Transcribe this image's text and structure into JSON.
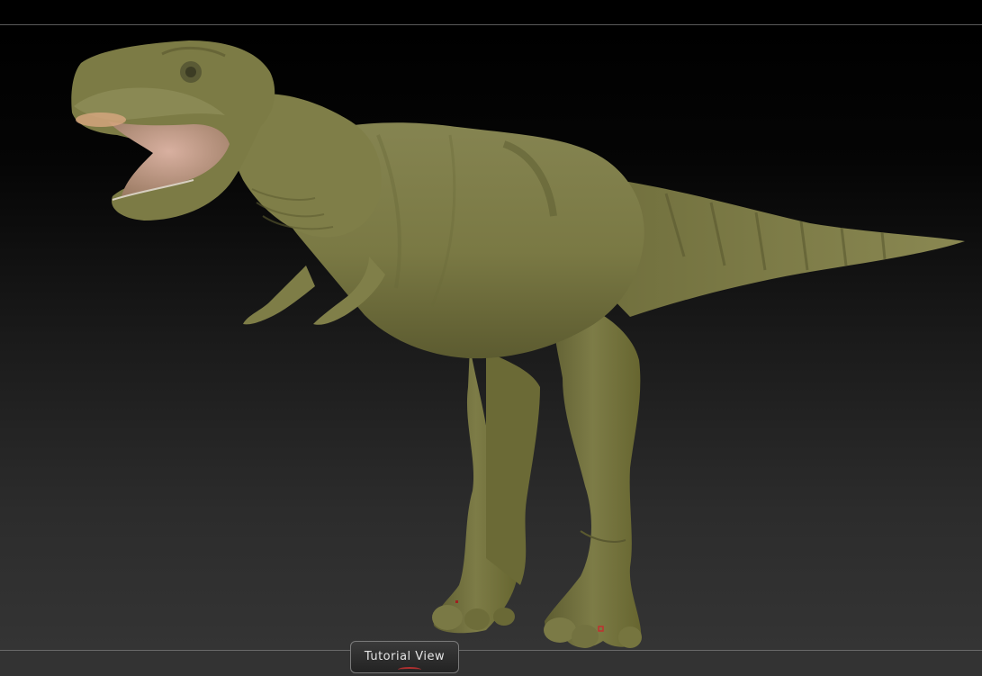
{
  "bottom_bar": {
    "tutorial_view_label": "Tutorial View"
  },
  "colors": {
    "background_top": "#000000",
    "background_bottom": "#343434",
    "model_skin": "#7e7d45",
    "model_skin_dark": "#545429",
    "mouth_interior": "#c49a88",
    "button_border": "#7a7a7a",
    "accent_red": "#b03030"
  },
  "icons": {
    "model_marker": "small-red-square-marker"
  }
}
